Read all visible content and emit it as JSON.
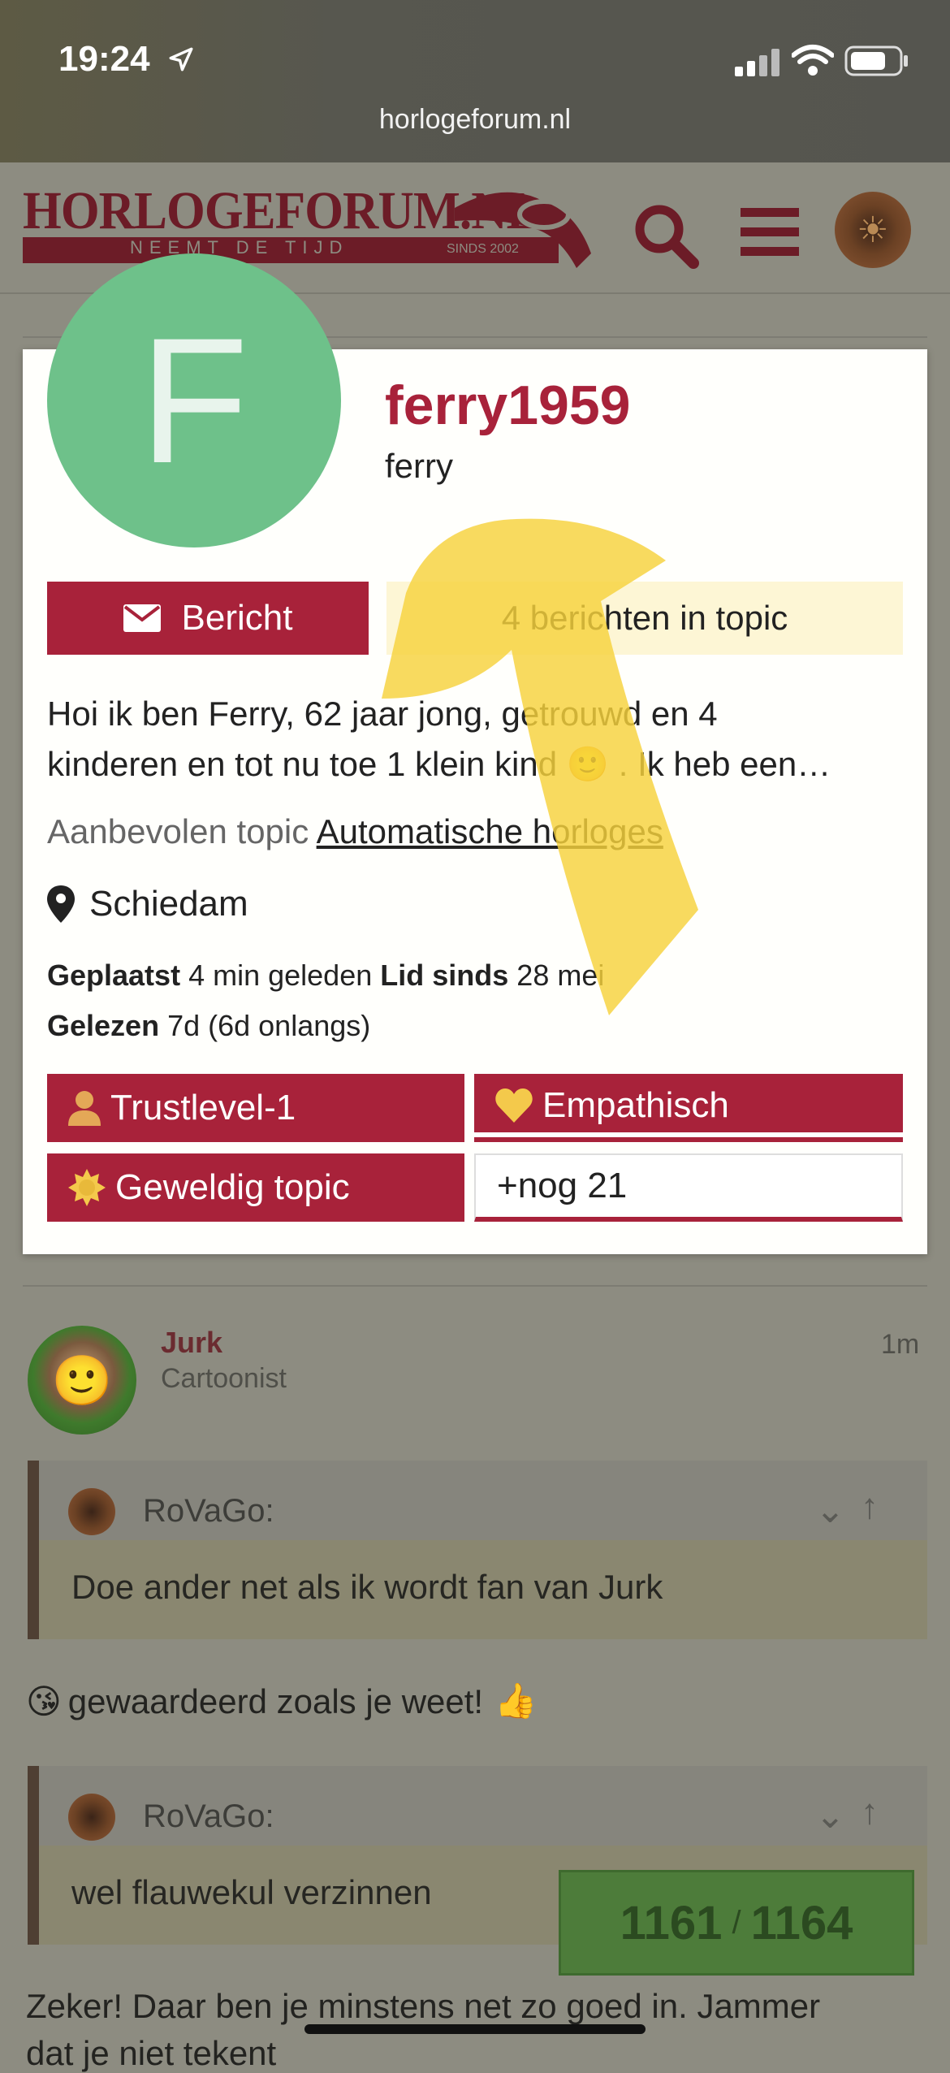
{
  "status_bar": {
    "time": "19:24",
    "url": "horlogeforum.nl"
  },
  "site": {
    "logo_text": "HORLOGEFORUM.NL",
    "logo_tagline": "NEEMT DE TIJD",
    "logo_since": "SINDS 2002",
    "brand_color": "#a8223a"
  },
  "user_card": {
    "avatar_letter": "F",
    "avatar_color": "#6ec18a",
    "username": "ferry1959",
    "full_name": "ferry",
    "message_button": "Bericht",
    "topic_posts_button": "4 berichten in topic",
    "bio_line1": "Hoi ik ben Ferry, 62 jaar jong, getrouwd en 4",
    "bio_line2": "kinderen en tot nu toe 1 klein kind 🙂 . Ik heb een…",
    "featured_label": "Aanbevolen topic",
    "featured_link": "Automatische horloges",
    "location": "Schiedam",
    "stats": {
      "posted_label": "Geplaatst",
      "posted_value": "4 min geleden",
      "member_since_label": "Lid sinds",
      "member_since_value": "28 mei",
      "read_label": "Gelezen",
      "read_value": "7d (6d onlangs)"
    },
    "badges": [
      {
        "label": "Trustlevel-1",
        "icon": "user-icon"
      },
      {
        "label": "Empathisch",
        "icon": "heart-icon"
      },
      {
        "label": "Geweldig topic",
        "icon": "sun-icon"
      }
    ],
    "more_badges": "+nog 21"
  },
  "background_post": {
    "username": "Jurk",
    "title": "Cartoonist",
    "time": "1m",
    "quote1_author": "RoVaGo:",
    "quote1_text": "Doe ander net als ik wordt fan van Jurk",
    "text1": "gewaardeerd zoals je weet!",
    "quote2_author": "RoVaGo:",
    "quote2_text": "wel flauwekul verzinnen",
    "text2_line1": "Zeker! Daar ben je minstens net zo goed in. Jammer",
    "text2_line2": "dat je niet tekent"
  },
  "progress": {
    "current": "1161",
    "separator": "/",
    "total": "1164"
  }
}
